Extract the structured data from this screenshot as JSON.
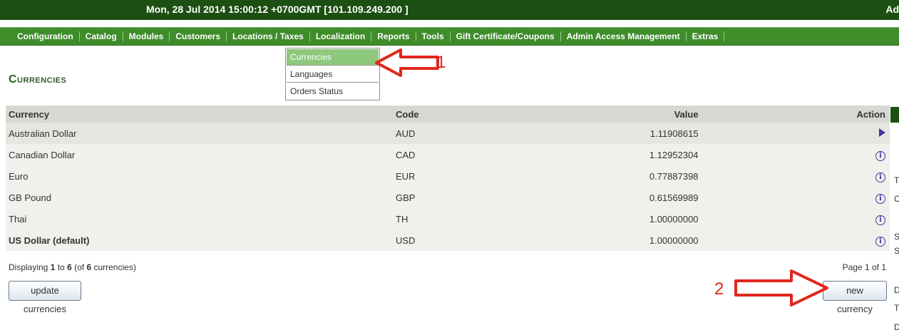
{
  "header": {
    "datetime": "Mon, 28 Jul 2014 15:00:12 +0700GMT [101.109.249.200 ]",
    "right_clip": "Ad"
  },
  "nav": {
    "items": [
      "Configuration",
      "Catalog",
      "Modules",
      "Customers",
      "Locations / Taxes",
      "Localization",
      "Reports",
      "Tools",
      "Gift Certificate/Coupons",
      "Admin Access Management",
      "Extras"
    ]
  },
  "dropdown": {
    "items": [
      "Currencies",
      "Languages",
      "Orders Status"
    ],
    "active": "Currencies"
  },
  "page": {
    "title": "Currencies"
  },
  "table": {
    "headers": {
      "currency": "Currency",
      "code": "Code",
      "value": "Value",
      "action": "Action"
    },
    "rows": [
      {
        "name": "Australian Dollar",
        "code": "AUD",
        "value": "1.11908615",
        "icon": "arrow-right-icon"
      },
      {
        "name": "Canadian Dollar",
        "code": "CAD",
        "value": "1.12952304",
        "icon": "info-icon"
      },
      {
        "name": "Euro",
        "code": "EUR",
        "value": "0.77887398",
        "icon": "info-icon"
      },
      {
        "name": "GB Pound",
        "code": "GBP",
        "value": "0.61569989",
        "icon": "info-icon"
      },
      {
        "name": "Thai",
        "code": "TH",
        "value": "1.00000000",
        "icon": "info-icon"
      },
      {
        "name": "US Dollar (default)",
        "code": "USD",
        "value": "1.00000000",
        "icon": "info-icon"
      }
    ]
  },
  "footer": {
    "displaying_prefix": "Displaying ",
    "from": "1",
    "to_word": " to ",
    "to": "6",
    "of_prefix": " (of ",
    "total": "6",
    "of_suffix": " currencies)",
    "page_info": "Page 1 of 1"
  },
  "buttons": {
    "update": "update currencies",
    "new": "new currency"
  },
  "side_letters": [
    "T",
    "C",
    "S",
    "S",
    "D",
    "T",
    "D"
  ],
  "annotations": {
    "one": "1",
    "two": "2"
  },
  "colors": {
    "topbar": "#1c4f12",
    "navbar": "#3e8c2a",
    "accent_red": "#e1261c",
    "title_green": "#2d5e21"
  }
}
